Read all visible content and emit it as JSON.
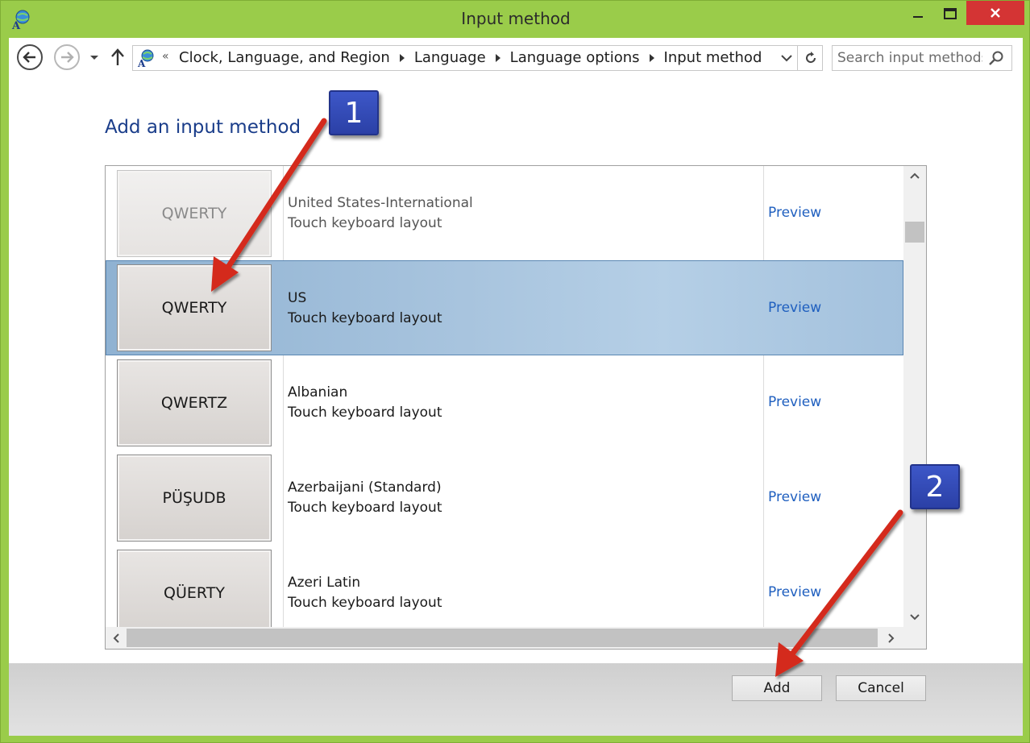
{
  "window": {
    "title": "Input method"
  },
  "nav": {
    "breadcrumb": [
      "Clock, Language, and Region",
      "Language",
      "Language options",
      "Input method"
    ],
    "search": {
      "placeholder": "Search input methods",
      "value": ""
    }
  },
  "main": {
    "heading": "Add an input method",
    "rows": [
      {
        "layout": "QWERTY",
        "name": "United States-International",
        "subtitle": "Touch keyboard layout",
        "preview": "Preview",
        "selected": false
      },
      {
        "layout": "QWERTY",
        "name": "US",
        "subtitle": "Touch keyboard layout",
        "preview": "Preview",
        "selected": true
      },
      {
        "layout": "QWERTZ",
        "name": "Albanian",
        "subtitle": "Touch keyboard layout",
        "preview": "Preview",
        "selected": false
      },
      {
        "layout": "PÜŞUDB",
        "name": "Azerbaijani (Standard)",
        "subtitle": "Touch keyboard layout",
        "preview": "Preview",
        "selected": false
      },
      {
        "layout": "QÜERTY",
        "name": "Azeri Latin",
        "subtitle": "Touch keyboard layout",
        "preview": "Preview",
        "selected": false
      }
    ]
  },
  "footer": {
    "add_label": "Add",
    "cancel_label": "Cancel"
  },
  "annotations": {
    "badge_1": "1",
    "badge_2": "2"
  },
  "colors": {
    "frame": "#9acc4a",
    "close_button": "#d43434",
    "heading": "#1a3d8a",
    "link": "#1f5fbf",
    "selection": "#a8c4de",
    "badge": "#3048b8",
    "arrow": "#d42a1e"
  },
  "icons": {
    "app": "language-globe-icon",
    "back": "back-arrow-icon",
    "forward": "forward-arrow-icon",
    "up": "up-arrow-icon",
    "refresh": "refresh-icon",
    "search": "search-icon"
  }
}
